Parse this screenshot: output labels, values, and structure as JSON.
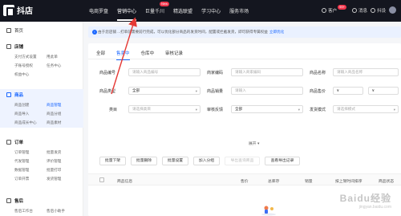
{
  "app": {
    "logo_text": "抖店"
  },
  "topnav": {
    "items": [
      {
        "label": "电商罗盘"
      },
      {
        "label": "营销中心"
      },
      {
        "label": "巨量千川",
        "badge": "New"
      },
      {
        "label": "精选联盟"
      },
      {
        "label": "学习中心"
      },
      {
        "label": "服务市场"
      }
    ],
    "active_index": 1,
    "right": {
      "customer": "客户",
      "message_badge": "99+",
      "message": "消息",
      "settings": "抖设"
    }
  },
  "sidebar": {
    "home": "首页",
    "sections": [
      {
        "title": "店铺",
        "items": [
          "支付方式设置",
          "用此单",
          "子账号授权",
          "任务中心",
          "权益中心"
        ]
      },
      {
        "title": "商品",
        "items": [
          "商品创建",
          "商品管理",
          "商品导入",
          "商品分组",
          "商品成长中心",
          "商品素材"
        ]
      },
      {
        "title": "订单",
        "items": [
          "订单管理",
          "批量发货",
          "代发管理",
          "评价管理",
          "数据管理",
          "批量打印",
          "订单开票",
          "发货管理"
        ]
      },
      {
        "title": "售后",
        "items": [
          "售后工作台",
          "售后小助手"
        ]
      }
    ],
    "active_item": "商品管理"
  },
  "notice": {
    "text": "由于您店铺 ...打单前需要前行完成，可以优化部分商品的发货时间，配置或拦截发货，即可获得专属权益",
    "link": "立即优化"
  },
  "tabs": [
    "全部",
    "售卖中",
    "仓库中",
    "审核记录"
  ],
  "active_tab": 1,
  "filters": {
    "row1": [
      {
        "label": "商品编号",
        "placeholder": "请输入商品编号"
      },
      {
        "label": "商家编码",
        "placeholder": "请输入商家编码"
      },
      {
        "label": "商品名称",
        "placeholder": "请输入商品名称"
      }
    ],
    "row2": [
      {
        "label": "商品类型",
        "value": "全部"
      },
      {
        "label": "商品销量",
        "placeholder": "请输入"
      },
      {
        "label": "商品售价",
        "placeholder": "¥"
      },
      {
        "label": "",
        "placeholder": "¥"
      }
    ],
    "row3": [
      {
        "label": "类目",
        "placeholder": "请选择类目"
      },
      {
        "label": "审核反馈",
        "value": "全部"
      },
      {
        "label": "发货模式",
        "placeholder": "请选择模式"
      }
    ],
    "expand": "展开"
  },
  "actions": [
    "批量下架",
    "批量删除",
    "批量设置",
    "加入分组",
    "导出查询商品",
    "查看导出记录"
  ],
  "table_headers": [
    "商品信息",
    "售价",
    "总库存",
    "销量",
    "按上架时间排序",
    "商品状态"
  ],
  "watermark": {
    "main": "Baidu经验",
    "sub": "jingyan.baidu.com"
  }
}
